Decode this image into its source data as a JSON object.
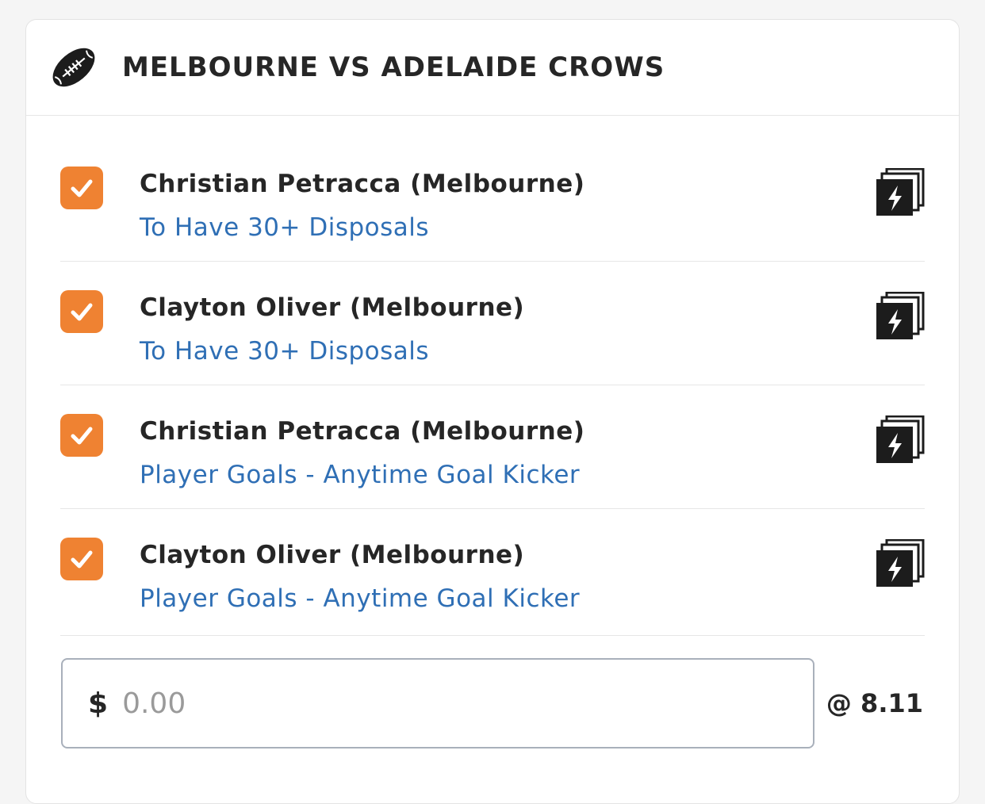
{
  "match": {
    "title": "MELBOURNE VS ADELAIDE CROWS",
    "sport_icon": "football-icon"
  },
  "accent_color": "#ef8232",
  "link_color": "#2f6fb5",
  "legs": [
    {
      "checked": true,
      "player": "Christian Petracca (Melbourne)",
      "market": "To Have 30+ Disposals",
      "icon": "same-game-multi-icon"
    },
    {
      "checked": true,
      "player": "Clayton Oliver (Melbourne)",
      "market": "To Have 30+ Disposals",
      "icon": "same-game-multi-icon"
    },
    {
      "checked": true,
      "player": "Christian Petracca (Melbourne)",
      "market": "Player Goals - Anytime Goal Kicker",
      "icon": "same-game-multi-icon"
    },
    {
      "checked": true,
      "player": "Clayton Oliver (Melbourne)",
      "market": "Player Goals - Anytime Goal Kicker",
      "icon": "same-game-multi-icon"
    }
  ],
  "stake": {
    "currency": "$",
    "value": "",
    "placeholder": "0.00"
  },
  "odds": "@ 8.11"
}
